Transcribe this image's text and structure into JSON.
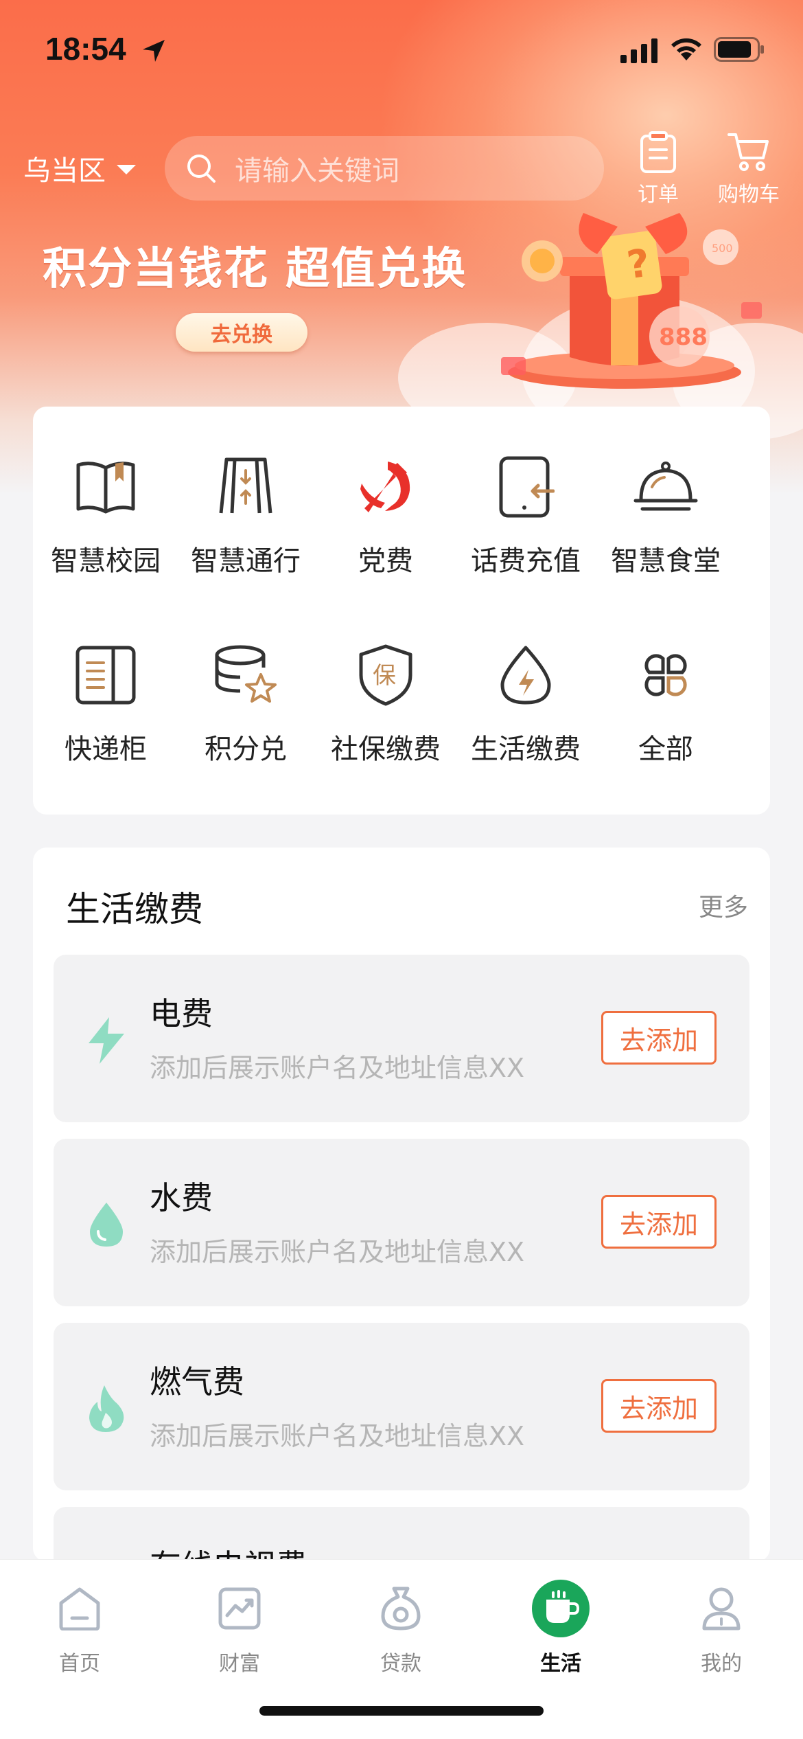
{
  "status_bar": {
    "time": "18:54"
  },
  "header": {
    "region": "乌当区",
    "search_placeholder": "请输入关键词",
    "orders_label": "订单",
    "cart_label": "购物车"
  },
  "banner": {
    "title": "积分当钱花 超值兑换",
    "button": "去兑换",
    "coin_label": "888",
    "coin_small": "500"
  },
  "services": [
    {
      "label": "智慧校园",
      "icon": "book-icon"
    },
    {
      "label": "智慧通行",
      "icon": "gate-icon"
    },
    {
      "label": "党费",
      "icon": "party-emblem-icon"
    },
    {
      "label": "话费充值",
      "icon": "phone-recharge-icon"
    },
    {
      "label": "智慧食堂",
      "icon": "dining-bell-icon"
    },
    {
      "label": "快递柜",
      "icon": "locker-icon"
    },
    {
      "label": "积分兑",
      "icon": "coins-star-icon"
    },
    {
      "label": "社保缴费",
      "icon": "shield-icon"
    },
    {
      "label": "生活缴费",
      "icon": "utility-drop-icon"
    },
    {
      "label": "全部",
      "icon": "all-grid-icon"
    }
  ],
  "bills": {
    "title": "生活缴费",
    "more": "更多",
    "items": [
      {
        "name": "电费",
        "desc": "添加后展示账户名及地址信息XX",
        "button": "去添加",
        "icon": "lightning-icon"
      },
      {
        "name": "水费",
        "desc": "添加后展示账户名及地址信息XX",
        "button": "去添加",
        "icon": "water-drop-icon"
      },
      {
        "name": "燃气费",
        "desc": "添加后展示账户名及地址信息XX",
        "button": "去添加",
        "icon": "flame-icon"
      },
      {
        "name": "有线电视费",
        "desc": "",
        "button": "",
        "icon": ""
      }
    ]
  },
  "tabbar": [
    {
      "label": "首页",
      "icon": "home-icon",
      "active": false
    },
    {
      "label": "财富",
      "icon": "wealth-chart-icon",
      "active": false
    },
    {
      "label": "贷款",
      "icon": "loan-bag-icon",
      "active": false
    },
    {
      "label": "生活",
      "icon": "cup-icon",
      "active": true
    },
    {
      "label": "我的",
      "icon": "profile-icon",
      "active": false
    }
  ],
  "colors": {
    "accent": "#ef6f3f",
    "hero": "#fb6d4a",
    "active_tab": "#1aa65a",
    "bill_icon": "#8fdcc2"
  }
}
